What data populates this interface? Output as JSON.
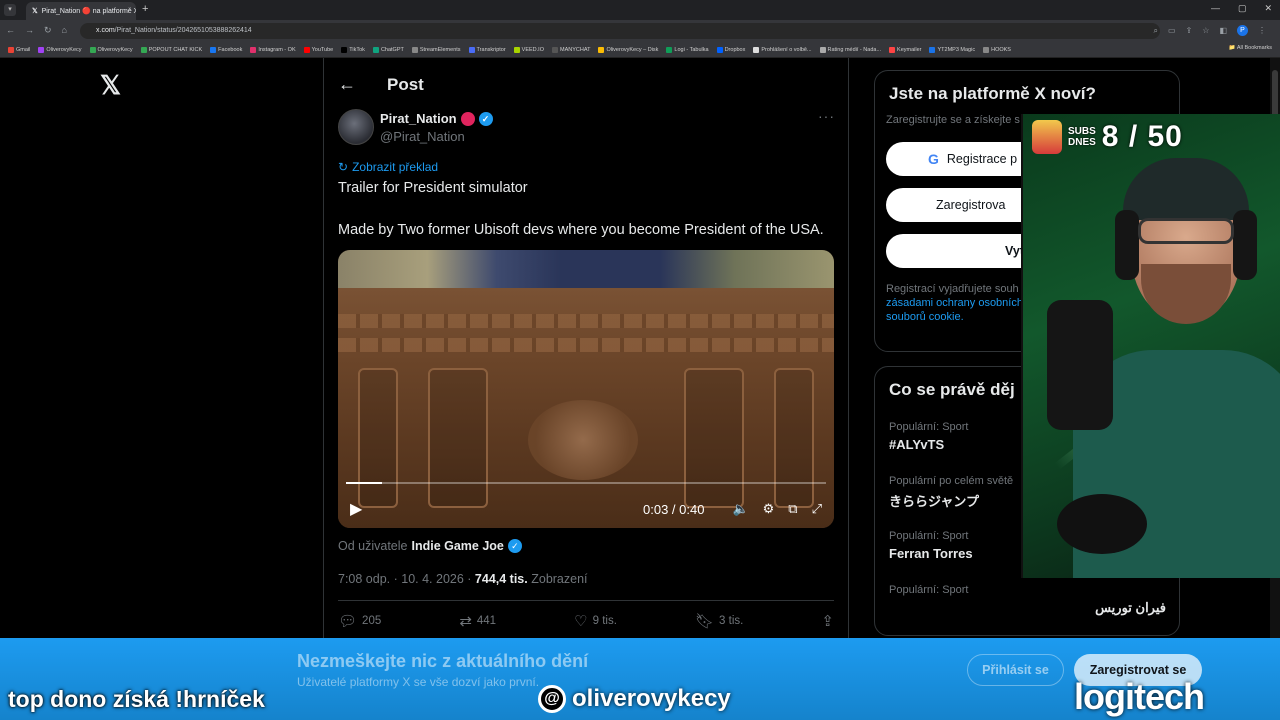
{
  "browser": {
    "tab_title": "Pirat_Nation 🔴 na platformě X",
    "url_domain": "x.com",
    "url_path": "/Pirat_Nation/status/2042651053888262414",
    "bookmarks": [
      "Gmail",
      "OliverovyKecy",
      "OliverovyKecy",
      "POPOUT CHAT KICK",
      "Facebook",
      "Instagram - OK",
      "YouTube",
      "TikTok",
      "ChatGPT",
      "StreamElements",
      "Transkriptor",
      "VEED.IO",
      "MANYCHAT",
      "OliverovyKecy – Disk",
      "Logi - Tabulka",
      "Dropbox",
      "Prohlášení o volbě...",
      "Rating médií - Nada...",
      "Keymailer",
      "YT2MP3 Magic",
      "HOOKS"
    ],
    "all_bookmarks": "All Bookmarks"
  },
  "post": {
    "header_title": "Post",
    "author_name": "Pirat_Nation",
    "author_handle": "@Pirat_Nation",
    "translate_label": "Zobrazit překlad",
    "text_line1": "Trailer for President simulator",
    "text_line2": "Made by Two former Ubisoft devs where you become President of the USA.",
    "video": {
      "time": "0:03 / 0:40",
      "progress": 0.075
    },
    "via_prefix": "Od uživatele",
    "via_user": "Indie Game Joe",
    "timestamp": "7:08 odp. · 10. 4. 2026 ·",
    "views_count": "744,4 tis.",
    "views_label": "Zobrazení",
    "actions": {
      "replies": "205",
      "reposts": "441",
      "likes": "9 tis.",
      "bookmarks": "3 tis."
    }
  },
  "sidebar": {
    "signup_title": "Jste na platformě X noví?",
    "signup_sub": "Zaregistrujte se a získejte s",
    "google_btn": "Registrace p",
    "apple_btn": "Zaregistrova",
    "create_btn": "Vytvoři",
    "legal_prefix": "Registrací vyjadřujete souh",
    "legal_link1": "zásadami ochrany osobních",
    "legal_link2": "souborů cookie.",
    "trends_title": "Co se právě děj",
    "trends": [
      {
        "category": "Populární: Sport",
        "name": "#ALYvTS"
      },
      {
        "category": "Populární po celém světě",
        "name": "きららジャンプ"
      },
      {
        "category": "Populární: Sport",
        "name": "Ferran Torres"
      },
      {
        "category": "Populární: Sport",
        "name": "فيران توريس"
      }
    ]
  },
  "banner": {
    "title": "Nezmeškejte nic z aktuálního dění",
    "subtitle": "Uživatelé platformy X se vše dozví jako první.",
    "login_btn": "Přihlásit se",
    "register_btn": "Zaregistrovat se"
  },
  "overlay": {
    "left_text": "top dono získá !hrníček",
    "channel": "oliverovykecy",
    "sponsor": "logitech",
    "subs_label_1": "SUBS",
    "subs_label_2": "DNES",
    "subs_count": "8 / 50"
  },
  "colors": {
    "accent": "#1d9bf0",
    "background": "#000000",
    "banner": "#1d9bf0",
    "muted": "#71767b"
  },
  "icons": [
    "x-logo-icon",
    "back-arrow-icon",
    "more-icon",
    "translate-icon",
    "play-icon",
    "volume-icon",
    "settings-icon",
    "pip-icon",
    "fullscreen-icon",
    "reply-icon",
    "repost-icon",
    "like-icon",
    "bookmark-icon",
    "share-icon",
    "google-icon",
    "apple-icon",
    "verified-icon",
    "threads-icon"
  ]
}
